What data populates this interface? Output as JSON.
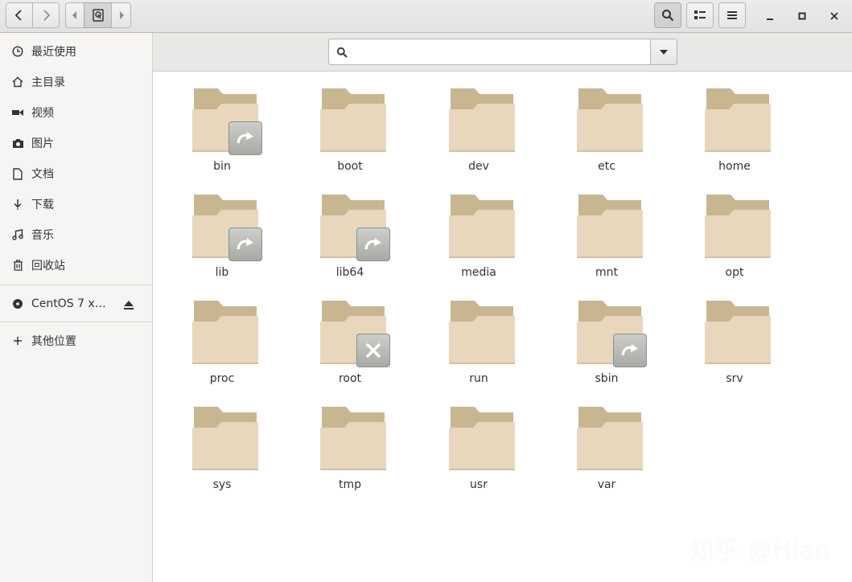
{
  "sidebar": {
    "items": [
      {
        "label": "最近使用",
        "icon": "clock-icon"
      },
      {
        "label": "主目录",
        "icon": "home-icon"
      },
      {
        "label": "视频",
        "icon": "video-icon"
      },
      {
        "label": "图片",
        "icon": "camera-icon"
      },
      {
        "label": "文档",
        "icon": "document-icon"
      },
      {
        "label": "下载",
        "icon": "download-icon"
      },
      {
        "label": "音乐",
        "icon": "music-icon"
      },
      {
        "label": "回收站",
        "icon": "trash-icon"
      }
    ],
    "device": {
      "label": "CentOS 7 x…",
      "icon": "disc-icon",
      "eject_icon": "eject-icon"
    },
    "other": {
      "label": "其他位置",
      "icon": "plus-icon"
    }
  },
  "search": {
    "value": "",
    "placeholder": ""
  },
  "folders": [
    {
      "name": "bin",
      "emblem": "symlink"
    },
    {
      "name": "boot",
      "emblem": ""
    },
    {
      "name": "dev",
      "emblem": ""
    },
    {
      "name": "etc",
      "emblem": ""
    },
    {
      "name": "home",
      "emblem": ""
    },
    {
      "name": "lib",
      "emblem": "symlink"
    },
    {
      "name": "lib64",
      "emblem": "symlink"
    },
    {
      "name": "media",
      "emblem": ""
    },
    {
      "name": "mnt",
      "emblem": ""
    },
    {
      "name": "opt",
      "emblem": ""
    },
    {
      "name": "proc",
      "emblem": ""
    },
    {
      "name": "root",
      "emblem": "unreadable"
    },
    {
      "name": "run",
      "emblem": ""
    },
    {
      "name": "sbin",
      "emblem": "symlink"
    },
    {
      "name": "srv",
      "emblem": ""
    },
    {
      "name": "sys",
      "emblem": ""
    },
    {
      "name": "tmp",
      "emblem": ""
    },
    {
      "name": "usr",
      "emblem": ""
    },
    {
      "name": "var",
      "emblem": ""
    }
  ],
  "watermark": "知乎 @Hian",
  "colors": {
    "folder_back": "#c8b691",
    "folder_front": "#e8d7bd",
    "emblem": "#b2b3af"
  }
}
